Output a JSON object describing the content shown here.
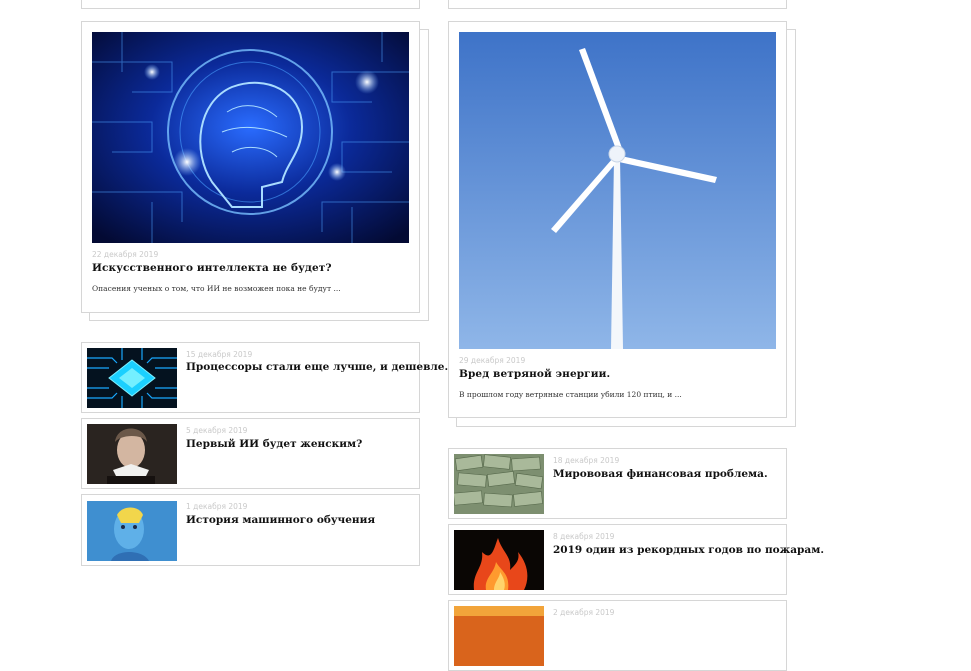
{
  "featured": [
    {
      "date": "22 декабря 2019",
      "title": "Искусственного интеллекта не будет?",
      "excerpt": "Опасения ученых о том, что ИИ не возможен пока не будут ...",
      "image_icon": "ai-brain-image"
    },
    {
      "date": "29 декабря 2019",
      "title": "Вред ветряной энергии.",
      "excerpt": "В прошлом году ветряные станции убили 120 птиц, и ...",
      "image_icon": "wind-turbine-image"
    }
  ],
  "left_list": [
    {
      "date": "15 декабря 2019",
      "title": "Процессоры стали еще лучше, и дешевле.",
      "image_icon": "processor-chip-image"
    },
    {
      "date": "5 декабря 2019",
      "title": "Первый ИИ будет женским?",
      "image_icon": "android-woman-image"
    },
    {
      "date": "1 декабря 2019",
      "title": "История машинного обучения",
      "image_icon": "painted-face-image"
    }
  ],
  "right_list": [
    {
      "date": "18 декабря 2019",
      "title": "Мирововая финансовая проблема.",
      "image_icon": "money-stacks-image"
    },
    {
      "date": "8 декабря 2019",
      "title": "2019 один из рекордных годов по пожарам.",
      "image_icon": "fire-image"
    },
    {
      "date": "2 декабря 2019",
      "title": "",
      "image_icon": "orange-image"
    }
  ]
}
